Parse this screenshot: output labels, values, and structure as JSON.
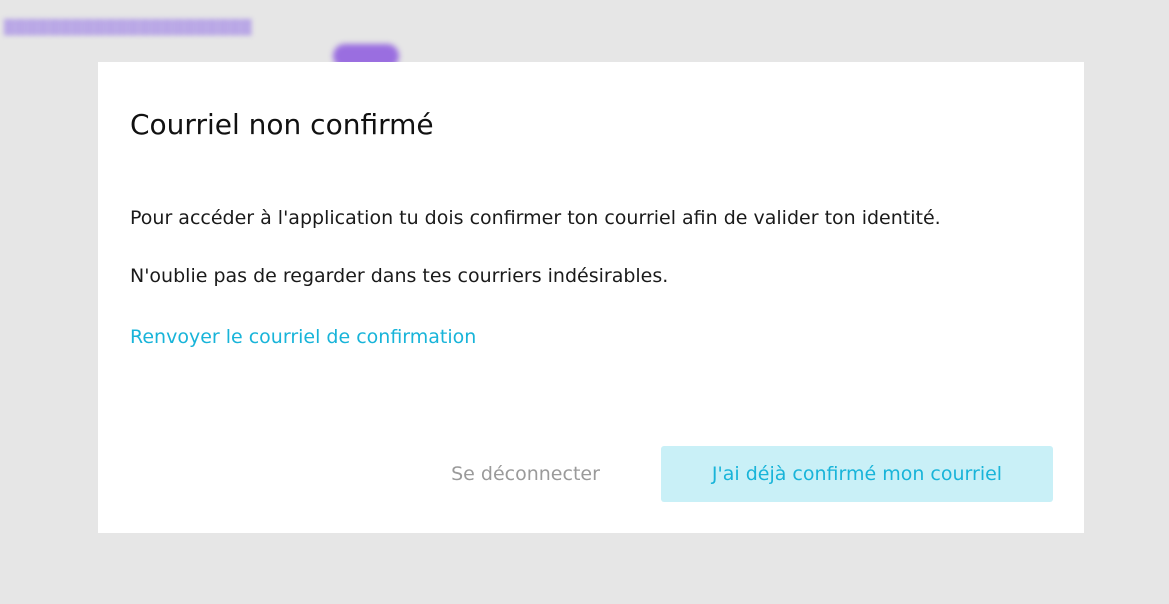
{
  "modal": {
    "title": "Courriel non confirmé",
    "message_1": "Pour accéder à l'application tu dois confirmer ton courriel afin de valider ton identité.",
    "message_2": "N'oublie pas de regarder dans tes courriers indésirables.",
    "resend_link": "Renvoyer le courriel de confirmation",
    "logout_button": "Se déconnecter",
    "confirmed_button": "J'ai déjà confirmé mon courriel"
  },
  "colors": {
    "accent": "#18b4d9",
    "accent_bg": "#c9f0f7",
    "muted": "#9a9a9a",
    "overlay": "#e6e6e6"
  }
}
